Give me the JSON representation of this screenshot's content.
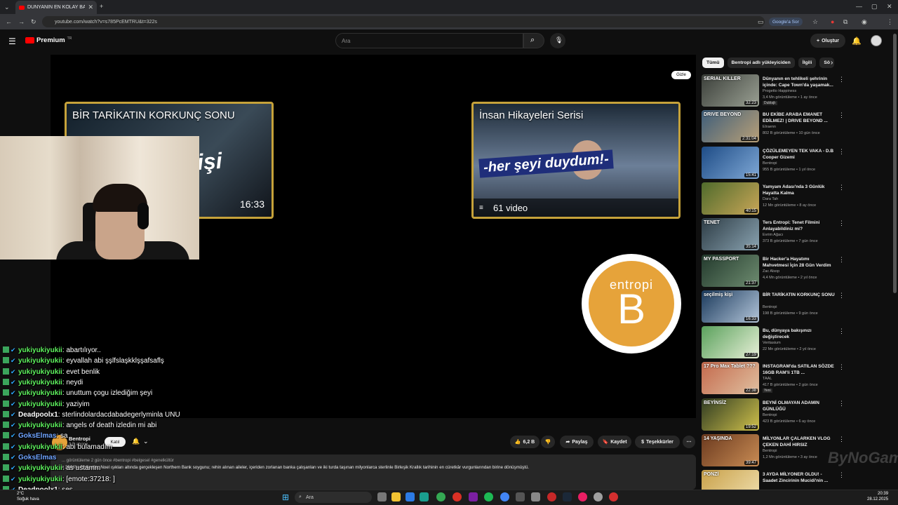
{
  "browser": {
    "tab_title": "DÜNYANIN EN KOLAY BANKA...",
    "url": "youtube.com/watch?v=s785PcEMTRU&t=322s",
    "google_btn": "Google'a Sor"
  },
  "youtube": {
    "logo": "Premium",
    "logo_sup": "TR",
    "search_placeholder": "Ara",
    "create_label": "Oluştur"
  },
  "player": {
    "card1_title": "BİR TARİKATIN KORKUNÇ SONU",
    "card1_big": "işi",
    "card1_duration": "16:33",
    "card2_title": "İnsan Hikayeleri Serisi",
    "card2_big": "-her şeyi duydum!-",
    "card2_count": "61 video",
    "hide_btn": "Gizle",
    "logo_word": "entropi",
    "logo_letter": "B"
  },
  "chat": [
    {
      "user": "yukiyukiyukii",
      "msg": ": abartılıyor..",
      "color": "green"
    },
    {
      "user": "yukiyukiyukii",
      "msg": ": eyvallah abi şşlfslaşkklşşafsaflş",
      "color": "green"
    },
    {
      "user": "yukiyukiyukii",
      "msg": ": evet benlik",
      "color": "green"
    },
    {
      "user": "yukiyukiyukii",
      "msg": ": neydi",
      "color": "green"
    },
    {
      "user": "yukiyukiyukii",
      "msg": ": unuttum çogu izlediğim şeyi",
      "color": "green"
    },
    {
      "user": "yukiyukiyukii",
      "msg": ": yaziyim",
      "color": "green"
    },
    {
      "user": "Deadpoolx1",
      "msg": ": sterlindolardacdabadegerlyminla UNU",
      "color": "white"
    },
    {
      "user": "yukiyukiyukii",
      "msg": ": angels of death izledin mi abi",
      "color": "green"
    },
    {
      "user": "GoksElmas",
      "msg": ": sa",
      "color": "blue"
    },
    {
      "user": "yukiyukiyukii",
      "msg": ": abi bulamadım",
      "color": "green"
    },
    {
      "user": "GoksElmas",
      "msg": "",
      "color": "blue"
    },
    {
      "user": "yukiyukiyukii",
      "msg": ": as ustamm",
      "color": "green"
    },
    {
      "user": "yukiyukiyukii",
      "msg": ": [emote:37218: ]",
      "color": "green"
    },
    {
      "user": "Deadpoolx1",
      "msg": ": ses",
      "color": "white"
    }
  ],
  "video": {
    "channel": "Bentropi",
    "subs": "9 B abone",
    "join": "Katıl",
    "likes": "6,2 B",
    "share": "Paylaş",
    "save": "Kaydet",
    "thanks": "Teşekkürler",
    "desc_top": "... görüntüleme  2 gün önce  #bentropi #belgesel #genelkültür",
    "desc_text": "k 2004'te Belfast'ta, Noel ışıkları altında gerçekleşen Northern Bank soygunu; rehin alınan aileler, içeriden zorlanan banka çalışanları ve iki turda taşınan milyonlarca sterlinle Birleşik Krallık tarihinin en cüretkâr vurgunlarından birine dönüşmüştü."
  },
  "chips": [
    "Tümü",
    "Bentropi adlı yükleyiciden",
    "İlgili",
    "Sö"
  ],
  "recs": [
    {
      "title": "Dünyanın en tehlikeli şehrinin içinde: Cape Town'da yaşamak...",
      "channel": "Progetto Happiness",
      "meta": "3,4 Mn görüntüleme • 1 ay önce",
      "dur": "32:23",
      "badge": "Dublajlı",
      "thumb": "SERIAL KILLER",
      "c1": "#3b3f3a",
      "c2": "#9aa093"
    },
    {
      "title": "BU EKİBE ARABA EMANET EDİLMEZ! | DRIVE BEYOND ...",
      "channel": "Elraenn",
      "meta": "802 B görüntüleme • 10 gün önce",
      "dur": "2:31:04",
      "badge": "",
      "thumb": "DRIVE BEYOND",
      "c1": "#3d5d7a",
      "c2": "#b9a077"
    },
    {
      "title": "ÇÖZÜLEMEYEN TEK VAKA - D.B Cooper Gizemi",
      "channel": "Bentropi",
      "meta": "955 B görüntüleme • 1 yıl önce",
      "dur": "15:41",
      "badge": "",
      "thumb": "",
      "c1": "#1e4c86",
      "c2": "#7fa8d6"
    },
    {
      "title": "Yamyam Adası'nda 3 Günlük Hayatta Kalma",
      "channel": "Dara Tah",
      "meta": "12 Mn görüntüleme • 8 ay önce",
      "dur": "40:15",
      "badge": "",
      "thumb": "",
      "c1": "#4f6b2c",
      "c2": "#c9a657"
    },
    {
      "title": "Ters Entropi: Tenet Filmini Anlayabildiniz mi?",
      "channel": "Evrim Ağacı",
      "meta": "373 B görüntüleme • 7 gün önce",
      "dur": "35:14",
      "badge": "",
      "thumb": "TENET",
      "c1": "#2d3c45",
      "c2": "#8aa3b1"
    },
    {
      "title": "Bir Hacker'a Hayatımı Mahvetmesi İçin 28 Gün Verdim",
      "channel": "Zac Alsop",
      "meta": "4,4 Mn görüntüleme • 2 yıl önce",
      "dur": "21:37",
      "badge": "",
      "thumb": "MY PASSPORT",
      "c1": "#233a2d",
      "c2": "#6e8c70"
    },
    {
      "title": "BİR TARİKATIN KORKUNÇ SONU",
      "channel": "Bentropi",
      "meta": "198 B görüntüleme • 9 gün önce",
      "dur": "16:33",
      "badge": "",
      "thumb": "seçilmiş kişi",
      "c1": "#1b3a5c",
      "c2": "#b3c5d9"
    },
    {
      "title": "Bu, dünyaya bakışınızı değiştirecek",
      "channel": "Veritasium",
      "meta": "22 Mn görüntüleme • 2 yıl önce",
      "dur": "27:19",
      "badge": "",
      "thumb": "",
      "c1": "#5aa15c",
      "c2": "#e8f0d8"
    },
    {
      "title": "INSTAGRAM'da SATILAN SÖZDE 16GB RAM'li 1TB ...",
      "channel": "TAAL",
      "meta": "417 B görüntüleme • 2 gün önce",
      "dur": "22:38",
      "badge": "Yeni",
      "thumb": "17 Pro Max Tablet ???",
      "c1": "#c46a4d",
      "c2": "#e0c0a0"
    },
    {
      "title": "BEYNİ OLMAYAN ADAMIN GÜNLÜĞÜ",
      "channel": "Bentropi",
      "meta": "423 B görüntüleme • 6 ay önce",
      "dur": "19:52",
      "badge": "",
      "thumb": "BEYİNSİZ",
      "c1": "#2f3b22",
      "c2": "#d0c14b"
    },
    {
      "title": "MİLYONLAR ÇALARKEN VLOG ÇEKEN DAHİ HIRSIZ",
      "channel": "Bentropi",
      "meta": "1,2 Mn görüntüleme • 3 ay önce",
      "dur": "39:47",
      "badge": "",
      "thumb": "14 YAŞINDA",
      "c1": "#6b3a1f",
      "c2": "#c98c54"
    },
    {
      "title": "3 AYDA MİLYONER OLDU! - Saadet Zincirinin Mucidi'nin ...",
      "channel": "",
      "meta": "",
      "dur": "",
      "badge": "",
      "thumb": "PONZİ",
      "c1": "#c9a14a",
      "c2": "#f0e0b0"
    }
  ],
  "taskbar": {
    "weather_temp": "2°C",
    "weather_text": "Soğuk hava",
    "search": "Ara",
    "time": "20:39",
    "date": "28.12.2025"
  },
  "watermark": "ByNoGame",
  "watermark_small": "com"
}
